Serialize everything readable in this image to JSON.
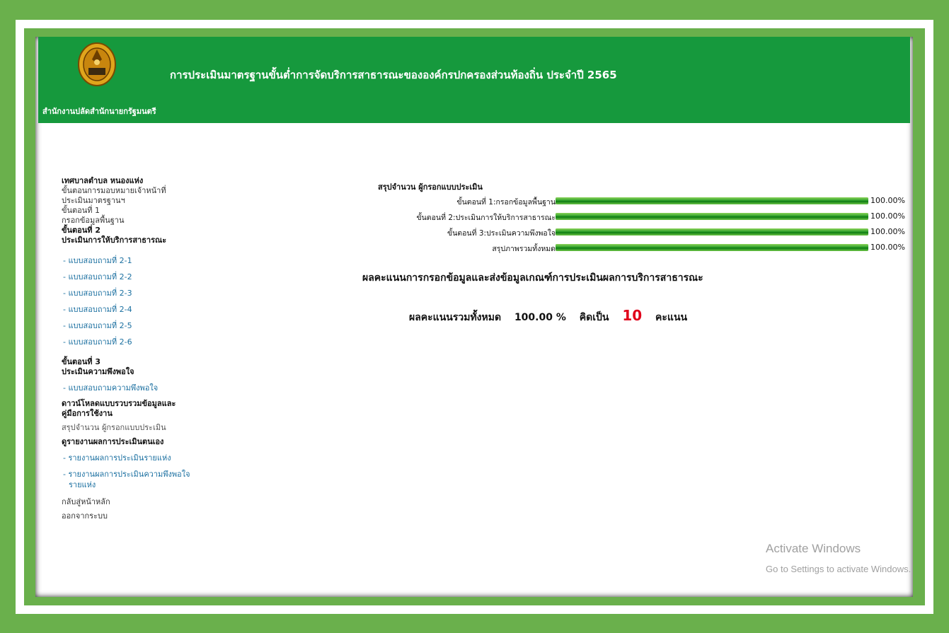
{
  "header": {
    "org_name": "สำนักงานปลัดสำนักนายกรัฐมนตรี",
    "title": "การประเมินมาตรฐานขั้นต่ำการจัดบริการสาธารณะขององค์กรปกครองส่วนท้องถิ่น ประจำปี 2565",
    "bg_color": "#16993d"
  },
  "sidebar": {
    "municipality": "เทศบาลตำบล หนองแห่ง",
    "assign_line1": "ขั้นตอนการมอบหมายเจ้าหน้าที่",
    "assign_line2": "ประเมินมาตรฐานฯ",
    "step1_title": "ขั้นตอนที่ 1",
    "step1_desc": "กรอกข้อมูลพื้นฐาน",
    "step2_title": "ขั้นตอนที่ 2",
    "step2_desc": "ประเมินการให้บริการสาธารณะ",
    "forms": [
      "- แบบสอบถามที่ 2-1",
      "- แบบสอบถามที่ 2-2",
      "- แบบสอบถามที่ 2-3",
      "- แบบสอบถามที่ 2-4",
      "- แบบสอบถามที่ 2-5",
      "- แบบสอบถามที่ 2-6"
    ],
    "step3_title": "ขั้นตอนที่ 3",
    "step3_desc": "ประเมินความพึงพอใจ",
    "satisfaction_form": "- แบบสอบถามความพึงพอใจ",
    "download_line1": "ดาวน์โหลดแบบรวบรวมข้อมูลและ",
    "download_line2": "คู่มือการใช้งาน",
    "summary_link": "สรุปจำนวน ผู้กรอกแบบประเมิน",
    "self_report": "ดูรายงานผลการประเมินตนเอง",
    "report_each": "- รายงานผลการประเมินรายแห่ง",
    "report_satisfaction_line1": "- รายงานผลการประเมินความพึงพอใจ",
    "report_satisfaction_line2": "รายแห่ง",
    "back_home": "กลับสู่หน้าหลัก",
    "logout": "ออกจากระบบ"
  },
  "summary": {
    "title": "สรุปจำนวน ผู้กรอกแบบประเมิน",
    "rows": [
      {
        "label": "ขั้นตอนที่ 1:กรอกข้อมูลพื้นฐาน",
        "progress": 1.0,
        "pct_text": "100.00%"
      },
      {
        "label": "ขั้นตอนที่ 2:ประเมินการให้บริการสาธารณะ",
        "progress": 1.0,
        "pct_text": "100.00%"
      },
      {
        "label": "ขั้นตอนที่ 3:ประเมินความพึงพอใจ",
        "progress": 1.0,
        "pct_text": "100.00%"
      },
      {
        "label": "สรุปภาพรวมทั้งหมด",
        "progress": 1.0,
        "pct_text": "100.00%"
      }
    ]
  },
  "result": {
    "heading": "ผลคะแนนการกรอกข้อมูลและส่งข้อมูลเกณฑ์การประเมินผลการบริการสาธารณะ",
    "total_label": "ผลคะแนนรวมทั้งหมด",
    "total_pct": "100.00 %",
    "equals_label": "คิดเป็น",
    "score": "10",
    "score_unit": "คะแนน",
    "score_color": "#e0001a"
  },
  "watermark": {
    "line1": "Activate Windows",
    "line2": "Go to Settings to activate Windows."
  }
}
